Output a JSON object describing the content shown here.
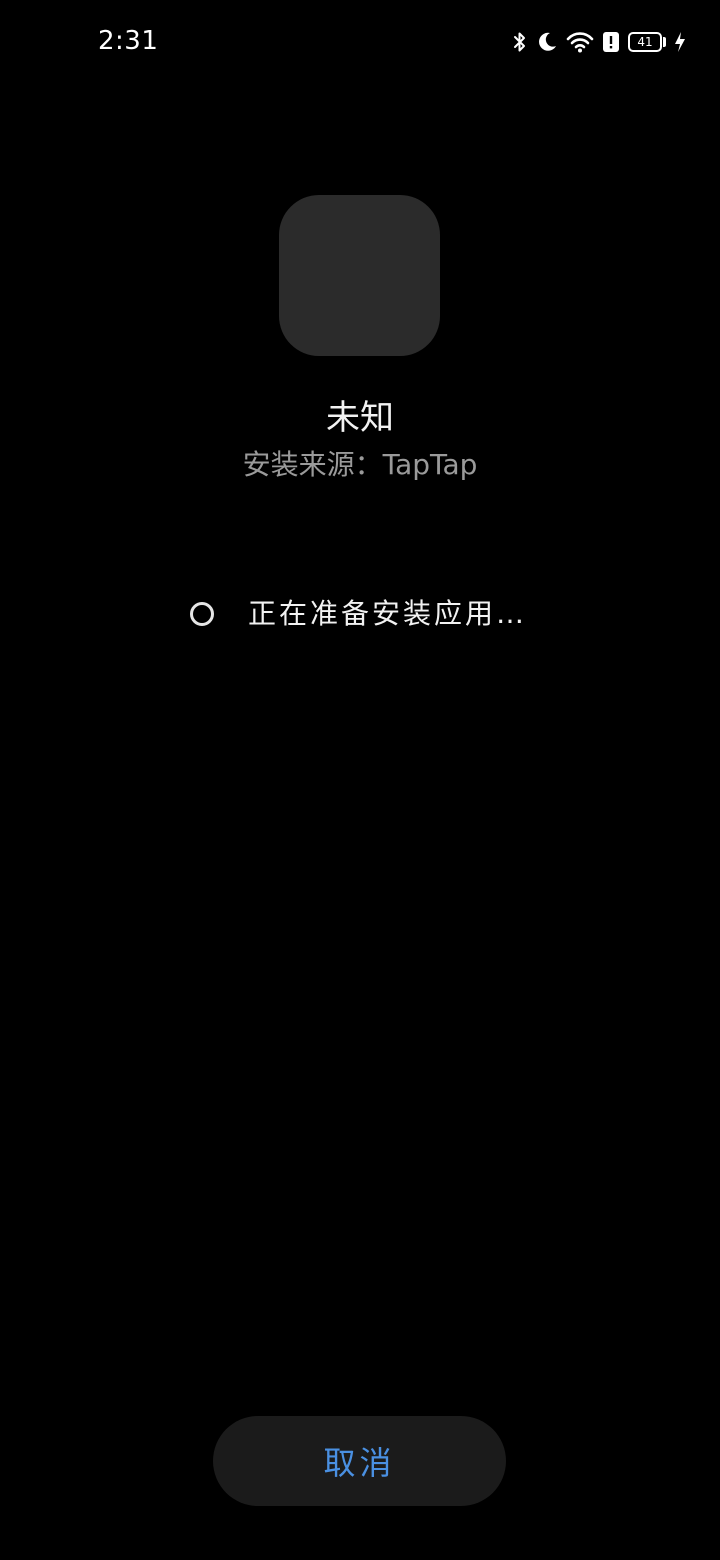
{
  "status_bar": {
    "time": "2:31",
    "battery": "41",
    "icons": [
      "bluetooth-icon",
      "moon-icon",
      "wifi-icon",
      "alert-icon",
      "battery-icon",
      "charging-icon"
    ]
  },
  "app": {
    "name": "未知",
    "source": "安装来源：TapTap"
  },
  "progress": {
    "text": "正在准备安装应用…"
  },
  "actions": {
    "cancel_label": "取消"
  },
  "colors": {
    "background": "#000000",
    "accent": "#4a90e2",
    "icon_placeholder": "#2b2b2b",
    "button_bg": "#1b1b1b"
  }
}
